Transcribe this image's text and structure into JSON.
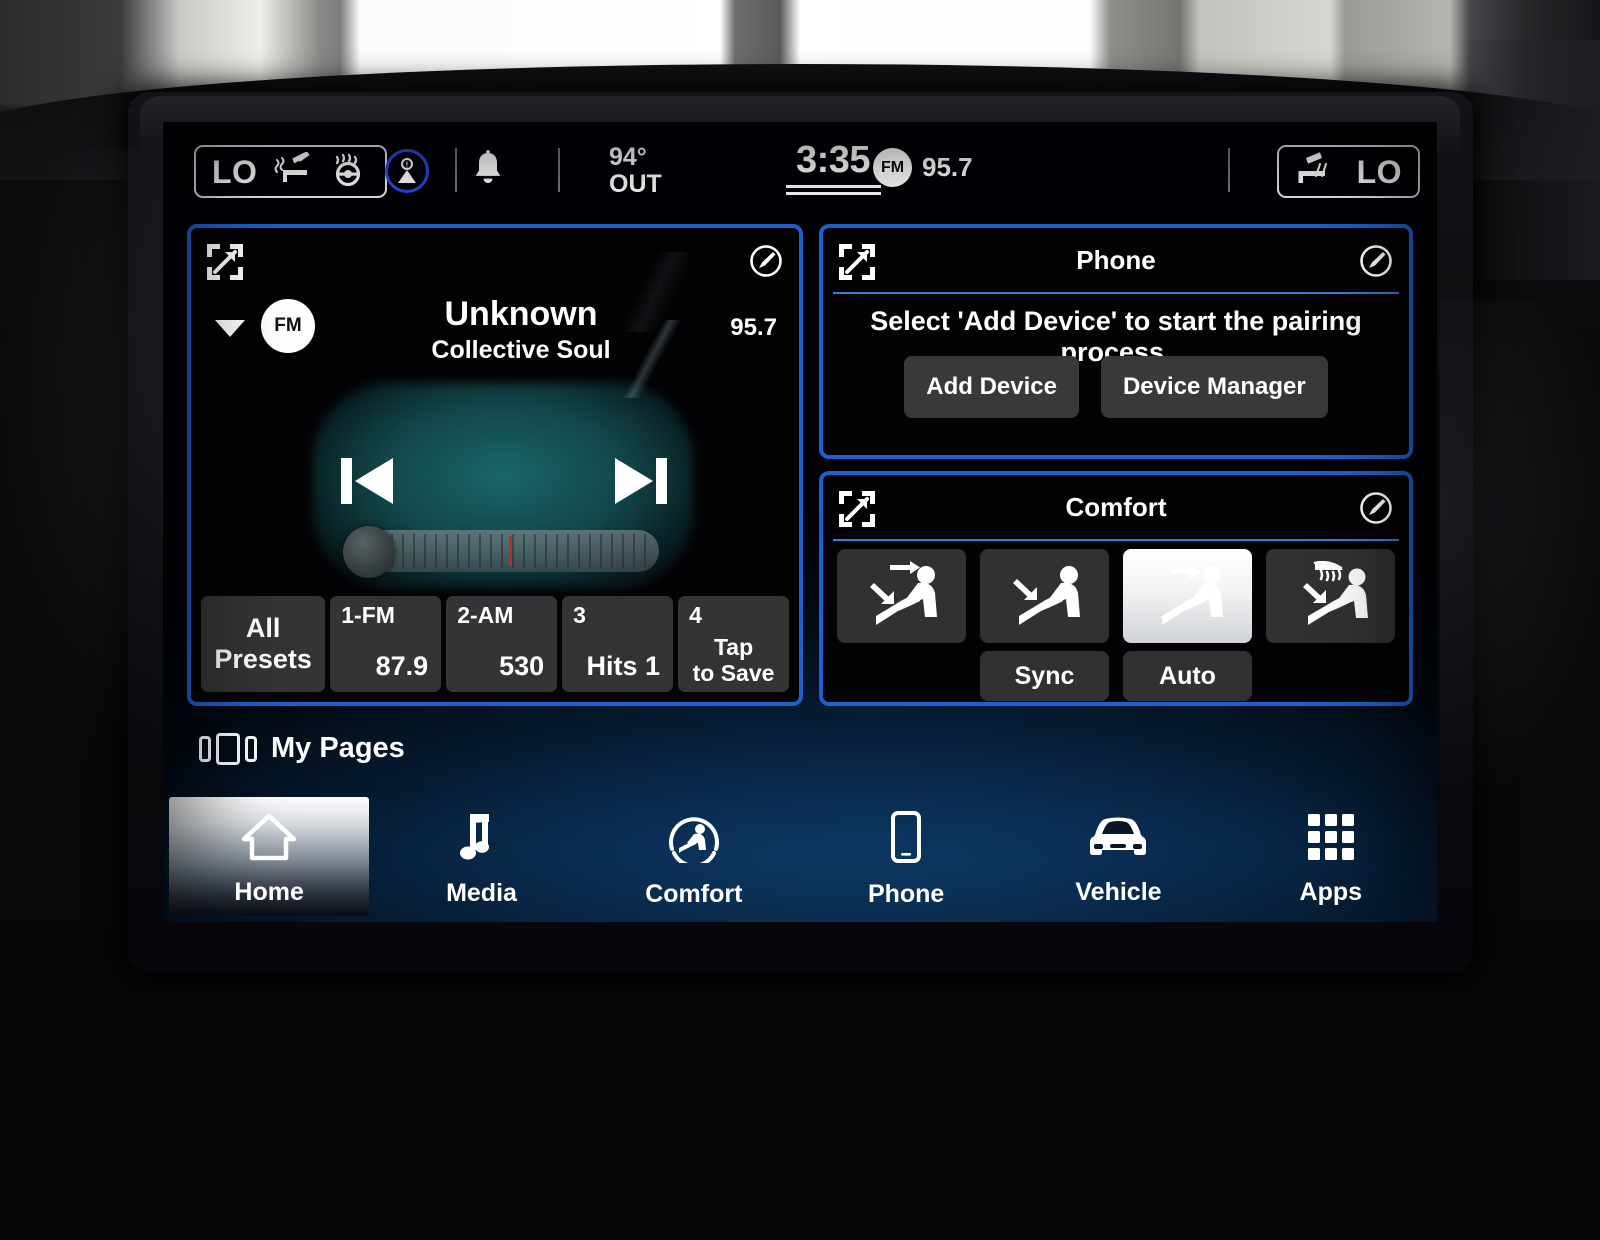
{
  "status_bar": {
    "left_climate": {
      "temp_label": "LO",
      "icons": [
        "heated-seat-icon",
        "heated-steering-wheel-icon"
      ]
    },
    "occupant_icon": "occupant-alert-icon",
    "notification_icon": "bell-icon",
    "outside_temp": {
      "value": "94°",
      "unit": "OUT"
    },
    "clock": "3:35",
    "now_playing_band": "FM",
    "now_playing_freq": "95.7",
    "right_climate": {
      "temp_label": "LO",
      "icons": [
        "ventilated-seat-icon"
      ]
    }
  },
  "media_card": {
    "expand_icon": "expand-icon",
    "edit_icon": "edit-icon",
    "source_badge": "FM",
    "track_title": "Unknown",
    "track_artist": "Collective Soul",
    "frequency": "95.7",
    "prev_icon": "skip-previous-icon",
    "next_icon": "skip-next-icon",
    "presets": [
      {
        "label_top": "",
        "label_main": "All\nPresets",
        "type": "all"
      },
      {
        "num": "1-FM",
        "value": "87.9"
      },
      {
        "num": "2-AM",
        "value": "530"
      },
      {
        "num": "3",
        "value": "Hits 1"
      },
      {
        "num": "4",
        "value": "Tap\nto Save"
      }
    ],
    "preset_all_line1": "All",
    "preset_all_line2": "Presets",
    "preset1_num": "1-FM",
    "preset1_val": "87.9",
    "preset2_num": "2-AM",
    "preset2_val": "530",
    "preset3_num": "3",
    "preset3_val": "Hits 1",
    "preset4_num": "4",
    "preset4_val_l1": "Tap",
    "preset4_val_l2": "to Save"
  },
  "phone_card": {
    "title": "Phone",
    "expand_icon": "expand-icon",
    "edit_icon": "edit-icon",
    "message": "Select 'Add Device' to start the pairing process.",
    "add_device_label": "Add Device",
    "device_manager_label": "Device Manager"
  },
  "comfort_card": {
    "title": "Comfort",
    "expand_icon": "expand-icon",
    "edit_icon": "edit-icon",
    "seat_buttons": [
      {
        "name": "seat-airflow-face-feet-icon",
        "active": false
      },
      {
        "name": "seat-airflow-feet-icon",
        "active": false
      },
      {
        "name": "seat-airflow-face-icon",
        "active": true
      },
      {
        "name": "seat-defrost-feet-icon",
        "active": false
      }
    ],
    "sync_label": "Sync",
    "auto_label": "Auto"
  },
  "my_pages": {
    "label": "My Pages",
    "indicator_icon": "page-indicator-icon"
  },
  "nav": {
    "items": [
      {
        "label": "Home",
        "icon": "home-icon",
        "active": true
      },
      {
        "label": "Media",
        "icon": "music-note-icon",
        "active": false
      },
      {
        "label": "Comfort",
        "icon": "comfort-seat-icon",
        "active": false
      },
      {
        "label": "Phone",
        "icon": "phone-icon",
        "active": false
      },
      {
        "label": "Vehicle",
        "icon": "car-icon",
        "active": false
      },
      {
        "label": "Apps",
        "icon": "grid-apps-icon",
        "active": false
      }
    ],
    "home_label": "Home",
    "media_label": "Media",
    "comfort_label": "Comfort",
    "phone_label": "Phone",
    "vehicle_label": "Vehicle",
    "apps_label": "Apps"
  },
  "colors": {
    "accent_blue": "#1f5fd0",
    "rule_blue": "#2f82d8",
    "card_bg": "#030305",
    "button_bg": "#39393b",
    "occupant_ring": "#2b49e8"
  }
}
